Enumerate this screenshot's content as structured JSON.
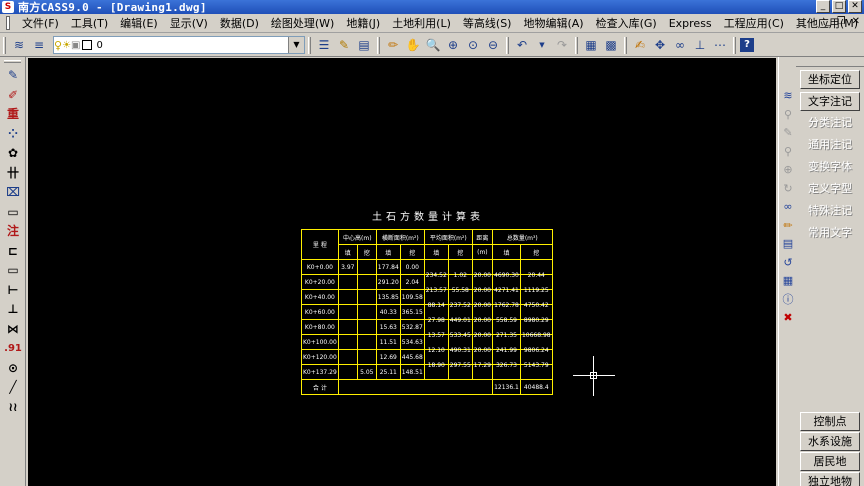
{
  "window": {
    "title": "南方CASS9.0 - [Drawing1.dwg]",
    "min": "_",
    "max": "□",
    "close": "✕"
  },
  "menubar": {
    "items": [
      "文件(F)",
      "工具(T)",
      "编辑(E)",
      "显示(V)",
      "数据(D)",
      "绘图处理(W)",
      "地籍(J)",
      "土地利用(L)",
      "等高线(S)",
      "地物编辑(A)",
      "检查入库(G)",
      "Express",
      "工程应用(C)",
      "其他应用(M)"
    ],
    "mdi_min": "_",
    "mdi_restore": "❐",
    "mdi_close": "✕"
  },
  "toolbar": {
    "layer_name": "0"
  },
  "drawing": {
    "title": "土石方数量计算表",
    "header": {
      "station": "里  程",
      "center_height": "中心高(m)",
      "section_area": "横断面积(m²)",
      "avg_area": "平均面积(m²)",
      "distance": "距离",
      "distance_unit": "(m)",
      "volume": "总数量(m³)",
      "fill": "填",
      "cut": "挖"
    },
    "stations": [
      "K0+0.00",
      "K0+20.00",
      "K0+40.00",
      "K0+60.00",
      "K0+80.00",
      "K0+100.00",
      "K0+120.00",
      "K0+137.29"
    ],
    "center_fill": [
      "3.97",
      "",
      "",
      "",
      "",
      "",
      "",
      ""
    ],
    "center_cut": [
      "",
      "",
      "",
      "",
      "",
      "",
      "",
      "5.05"
    ],
    "area_fill": [
      "177.84",
      "291.20",
      "135.85",
      "40.33",
      "15.63",
      "11.51",
      "12.69",
      "25.11"
    ],
    "area_cut": [
      "0.00",
      "2.04",
      "109.58",
      "365.15",
      "532.87",
      "534.63",
      "445.68",
      "148.51"
    ],
    "avg_fill": [
      "234.52",
      "213.57",
      "88.14",
      "27.98",
      "13.57",
      "12.10",
      "18.90"
    ],
    "avg_cut": [
      "1.02",
      "55.58",
      "237.52",
      "449.01",
      "533.45",
      "490.31",
      "297.55"
    ],
    "dist": [
      "20.00",
      "20.00",
      "20.00",
      "20.00",
      "20.00",
      "20.00",
      "17.29"
    ],
    "vol_fill": [
      "4690.30",
      "4271.41",
      "1762.78",
      "558.59",
      "271.35",
      "241.99",
      "326.73"
    ],
    "vol_cut": [
      "20.44",
      "1119.25",
      "4750.42",
      "8980.29",
      "10668.98",
      "9806.24",
      "5143.79"
    ],
    "total_label": "合  计",
    "total_fill": "12136.1",
    "total_cut": "40488.4"
  },
  "right_panel": {
    "items": [
      "坐标定位",
      "文字注记",
      "分类注记",
      "通用注记",
      "变换字体",
      "定义字型",
      "特殊注记",
      "常用文字"
    ],
    "bottom_items": [
      "控制点",
      "水系设施",
      "居民地",
      "独立地物"
    ]
  }
}
